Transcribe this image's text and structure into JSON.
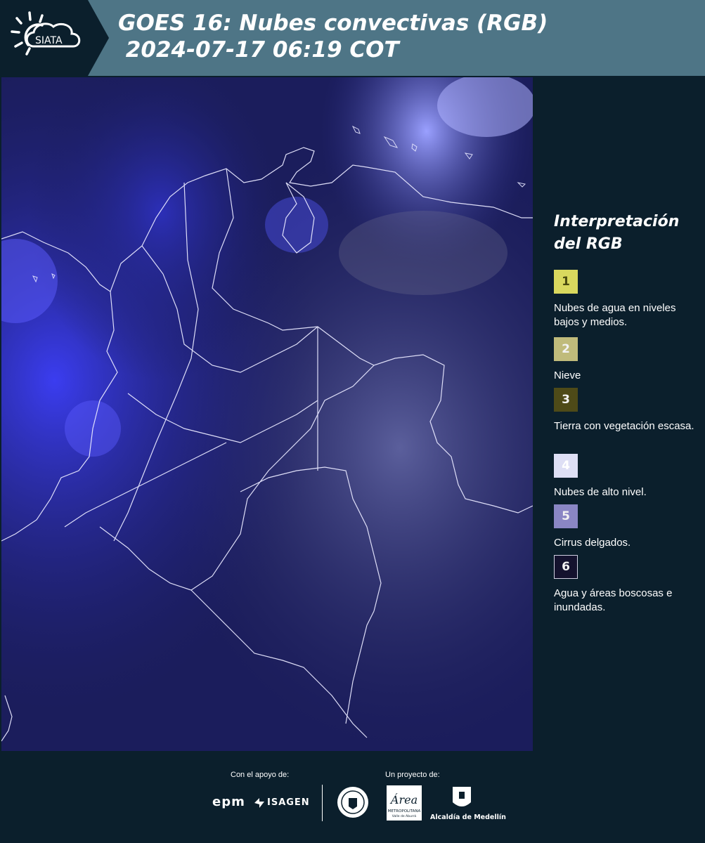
{
  "header": {
    "logo_text": "SIATA",
    "title": "GOES 16: Nubes convectivas (RGB)\n 2024-07-17 06:19 COT"
  },
  "legend": {
    "title": "Interpretación del RGB",
    "items": [
      {
        "num": "1",
        "label": "Nubes de agua en niveles bajos y medios.",
        "color": "#d9d85e"
      },
      {
        "num": "2",
        "label": "Nieve",
        "color": "#c0bb7b"
      },
      {
        "num": "3",
        "label": "Tierra con vegetación escasa.",
        "color": "#4e4a18"
      },
      {
        "num": "4",
        "label": "Nubes de alto nivel.",
        "color": "#dedff5"
      },
      {
        "num": "5",
        "label": "Cirrus delgados.",
        "color": "#8a86c4"
      },
      {
        "num": "6",
        "label": "Agua y áreas boscosas e inundadas.",
        "color": "#14122e"
      }
    ]
  },
  "footer": {
    "support_label": "Con el apoyo de:",
    "project_label": "Un proyecto de:",
    "epm": "epm",
    "isagen": "ISAGEN",
    "area_name": "Área",
    "area_sub": "METROPOLITANA",
    "area_sub2": "Valle de Aburrá",
    "alcaldia": "Alcaldía de Medellín"
  }
}
